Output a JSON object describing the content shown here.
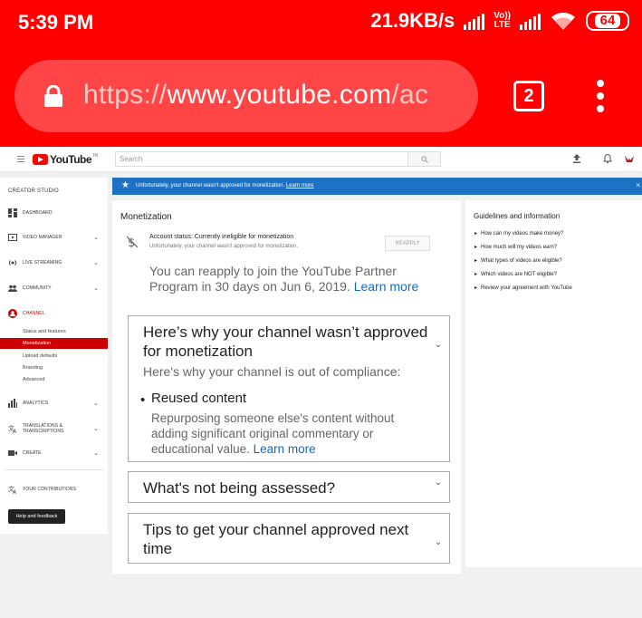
{
  "status_bar": {
    "time": "5:39 PM",
    "net_speed": "21.9KB/s",
    "volte_line1": "Vo))",
    "volte_line2": "LTE",
    "battery": "64"
  },
  "browser": {
    "url_dim_start": "https://",
    "url_main": "www.youtube.com",
    "url_dim_end": "/ac",
    "tab_count": "2"
  },
  "youtube": {
    "logo_text": "YouTube",
    "logo_country": "IN",
    "search_placeholder": "Search"
  },
  "sidebar": {
    "title": "CREATOR STUDIO",
    "items": [
      {
        "label": "DASHBOARD"
      },
      {
        "label": "VIDEO MANAGER"
      },
      {
        "label": "LIVE STREAMING"
      },
      {
        "label": "COMMUNITY"
      },
      {
        "label": "CHANNEL"
      },
      {
        "label": "ANALYTICS"
      },
      {
        "label": "TRANSLATIONS &",
        "label2": "TRANSCRIPTIONS"
      },
      {
        "label": "CREATE"
      },
      {
        "label": "YOUR CONTRIBUTIONS"
      }
    ],
    "channel_sub": [
      "Status and features",
      "Monetization",
      "Upload defaults",
      "Branding",
      "Advanced"
    ],
    "help_button": "Help and feedback"
  },
  "banner": {
    "message": "Unfortunately, your channel wasn't approved for monetization.",
    "link": "Learn more",
    "close": "×"
  },
  "monetization": {
    "title": "Monetization",
    "account_status": "Account status: Currently ineligible for monetization",
    "account_sub": "Unfortunately, your channel wasn't approved for monetization.",
    "reapply_button": "REAPPLY",
    "reapply_text": "You can reapply to join the YouTube Partner Program in 30 days on Jun 6, 2019.",
    "reapply_link": "Learn more",
    "panel1": {
      "title": "Here’s why your channel wasn’t approved for monetization",
      "subtitle": "Here's why your channel is out of compliance:",
      "reason_title": "Reused content",
      "reason_desc": "Repurposing someone else's content without adding significant original commentary or educational value.",
      "reason_link": "Learn more"
    },
    "panel2": {
      "title": "What's not being assessed?"
    },
    "panel3": {
      "title": "Tips to get your channel approved next time"
    }
  },
  "guidelines": {
    "title": "Guidelines and information",
    "items": [
      "How can my videos make money?",
      "How much will my videos earn?",
      "What types of videos are eligible?",
      "Which videos are NOT eligible?",
      "Review your agreement with YouTube"
    ]
  }
}
